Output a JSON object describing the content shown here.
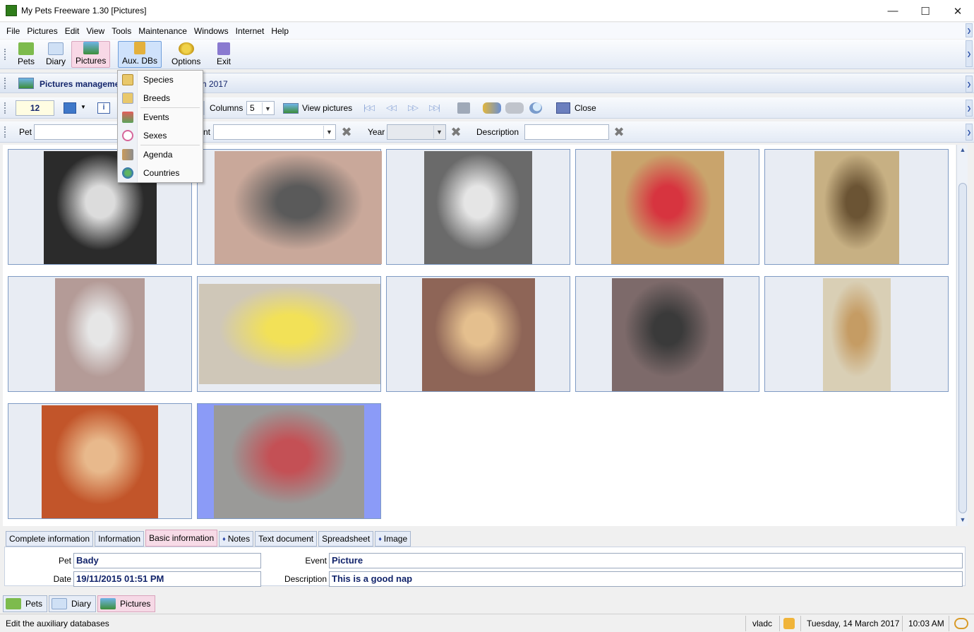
{
  "window": {
    "title": "My Pets Freeware 1.30 [Pictures]"
  },
  "menu": [
    "File",
    "Pictures",
    "Edit",
    "View",
    "Tools",
    "Maintenance",
    "Windows",
    "Internet",
    "Help"
  ],
  "toolbar": {
    "pets": "Pets",
    "diary": "Diary",
    "pictures": "Pictures",
    "aux_dbs": "Aux. DBs",
    "options": "Options",
    "exit": "Exit"
  },
  "aux_menu": [
    "Species",
    "Breeds",
    "Events",
    "Sexes",
    "Agenda",
    "Countries"
  ],
  "header": {
    "title_left": "Pictures manageme",
    "title_right": "h 2017"
  },
  "toolbar2": {
    "count": "12",
    "columns_label": "Columns",
    "columns_value": "5",
    "view_pictures": "View pictures",
    "close": "Close"
  },
  "filter": {
    "pet_label": "Pet",
    "event_label": "nt",
    "year_label": "Year",
    "description_label": "Description",
    "pet_value": "",
    "event_value": "",
    "year_value": "",
    "description_value": ""
  },
  "tabs": [
    "Complete information",
    "Information",
    "Basic information",
    "Notes",
    "Text document",
    "Spreadsheet",
    "Image"
  ],
  "active_tab": "Basic information",
  "details": {
    "pet_label": "Pet",
    "pet": "Bady",
    "date_label": "Date",
    "date": "19/11/2015 01:51 PM",
    "event_label": "Event",
    "event": "Picture",
    "description_label": "Description",
    "description": "This is a good nap"
  },
  "task_tabs": [
    "Pets",
    "Diary",
    "Pictures"
  ],
  "status": {
    "message": "Edit the auxiliary databases",
    "user": "vladc",
    "date": "Tuesday, 14 March 2017",
    "time": "10:03 AM"
  },
  "colors": {
    "accent": "#12246b",
    "selection": "#8b9bf7",
    "active_tab": "#f7dbe7"
  },
  "pictures": [
    {
      "fill": "#2b2b2b",
      "accent": "#dcdcdc"
    },
    {
      "fill": "#c9a89a",
      "accent": "#5a5a5a"
    },
    {
      "fill": "#6a6a6a",
      "accent": "#e5e5e5"
    },
    {
      "fill": "#c9a46c",
      "accent": "#d7343f"
    },
    {
      "fill": "#c7b083",
      "accent": "#6b5434"
    },
    {
      "fill": "#b49b97",
      "accent": "#e6e6e6"
    },
    {
      "fill": "#cfc7b8",
      "accent": "#f2e157"
    },
    {
      "fill": "#8e6557",
      "accent": "#e4bf8e"
    },
    {
      "fill": "#7d6a6a",
      "accent": "#3a3a3a"
    },
    {
      "fill": "#d9cfb5",
      "accent": "#c59c64"
    },
    {
      "fill": "#c2552a",
      "accent": "#e8b98c"
    },
    {
      "fill": "#9a9a98",
      "accent": "#c45055"
    }
  ]
}
